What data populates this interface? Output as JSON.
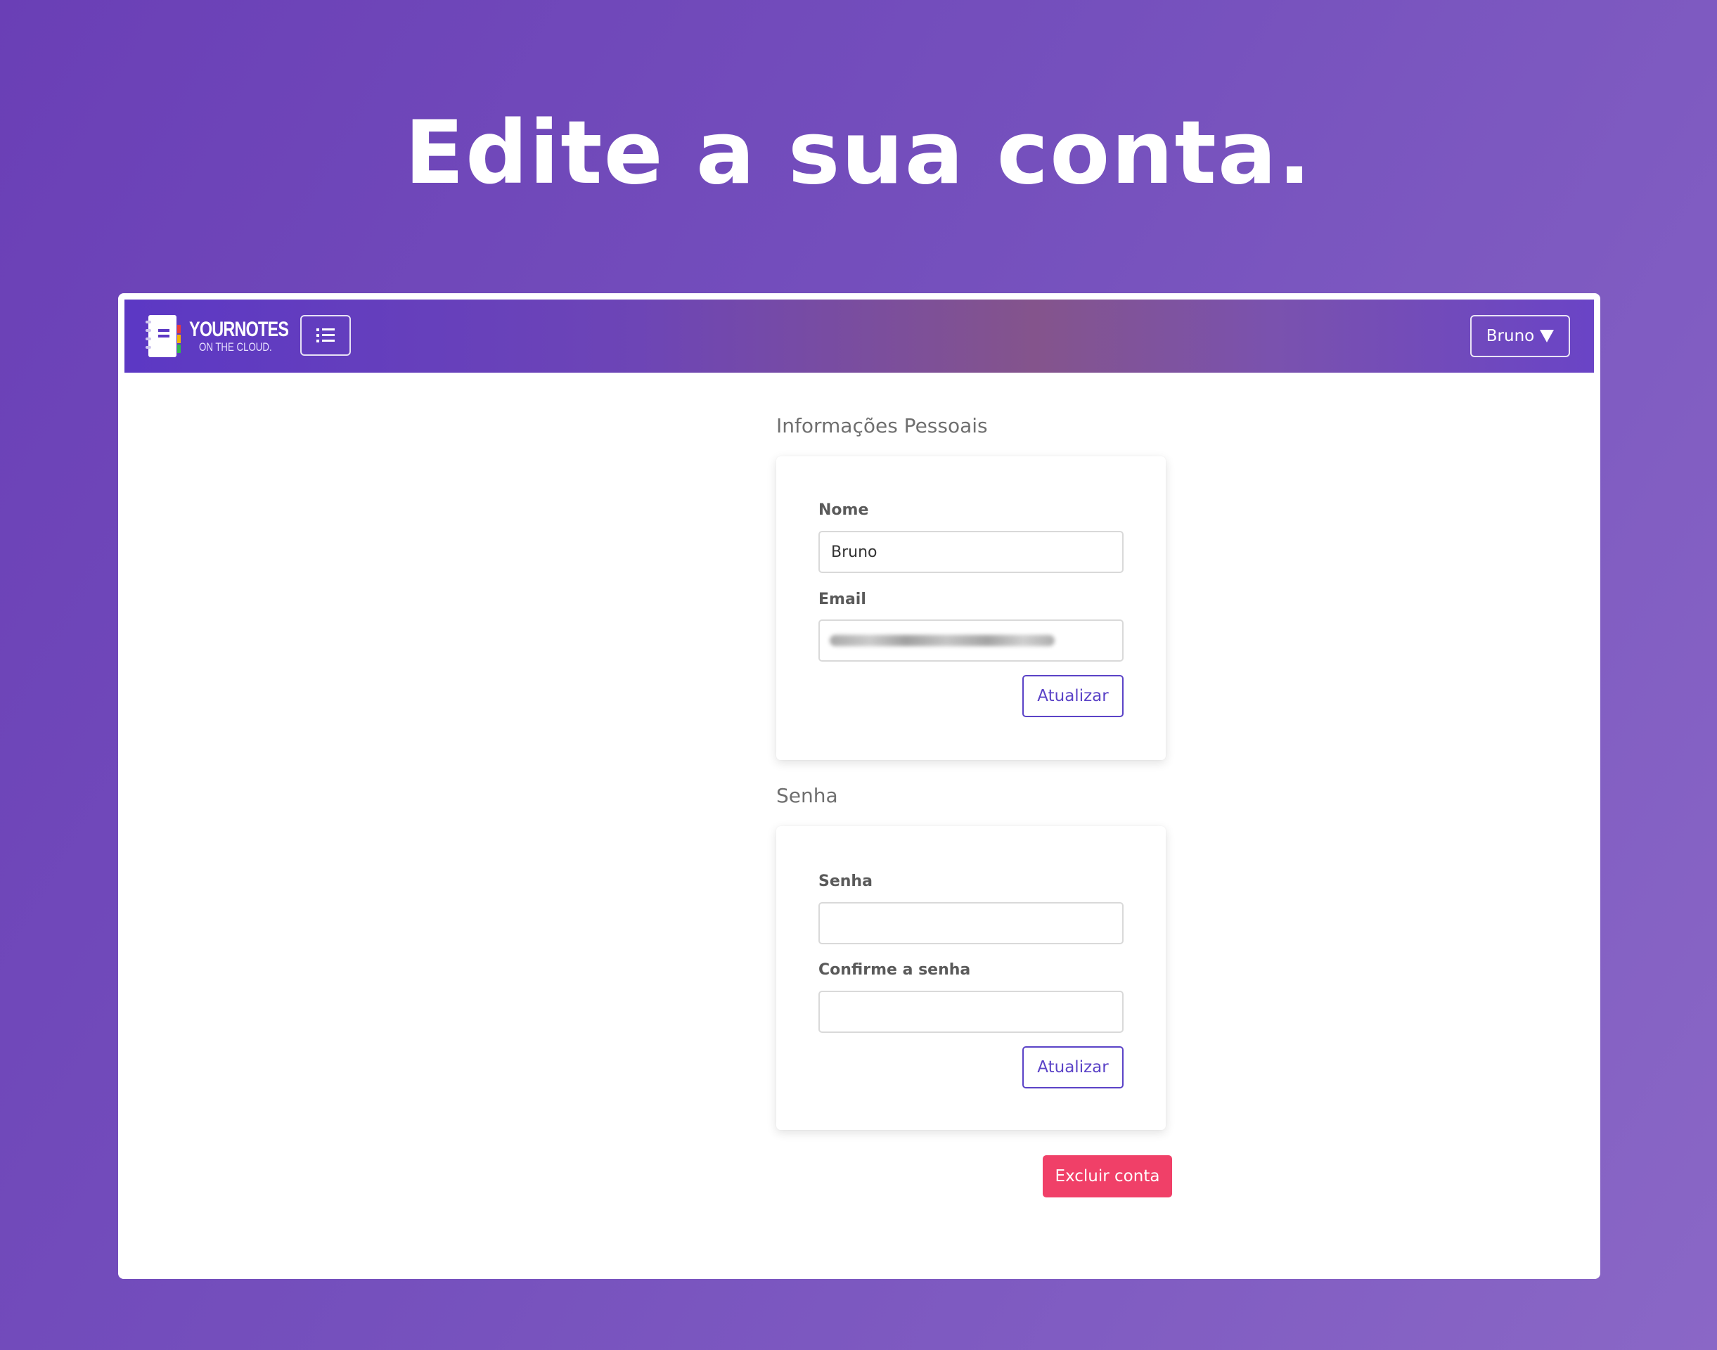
{
  "hero": {
    "title": "Edite a sua conta."
  },
  "navbar": {
    "brand_name": "YOURNOTES",
    "brand_tagline": "ON THE CLOUD.",
    "menu_toggle_icon": "list-icon",
    "user_label": "Bruno",
    "user_caret_icon": "caret-down-icon"
  },
  "personal_info": {
    "heading": "Informações Pessoais",
    "name_label": "Nome",
    "name_value": "Bruno",
    "email_label": "Email",
    "submit_label": "Atualizar"
  },
  "password": {
    "heading": "Senha",
    "password_label": "Senha",
    "password_value": "",
    "confirm_label": "Confirme a senha",
    "confirm_value": "",
    "submit_label": "Atualizar"
  },
  "delete_account": {
    "label": "Excluir conta"
  },
  "colors": {
    "background": "#7550bd",
    "accent": "#5b43c7",
    "danger": "#f04068"
  }
}
